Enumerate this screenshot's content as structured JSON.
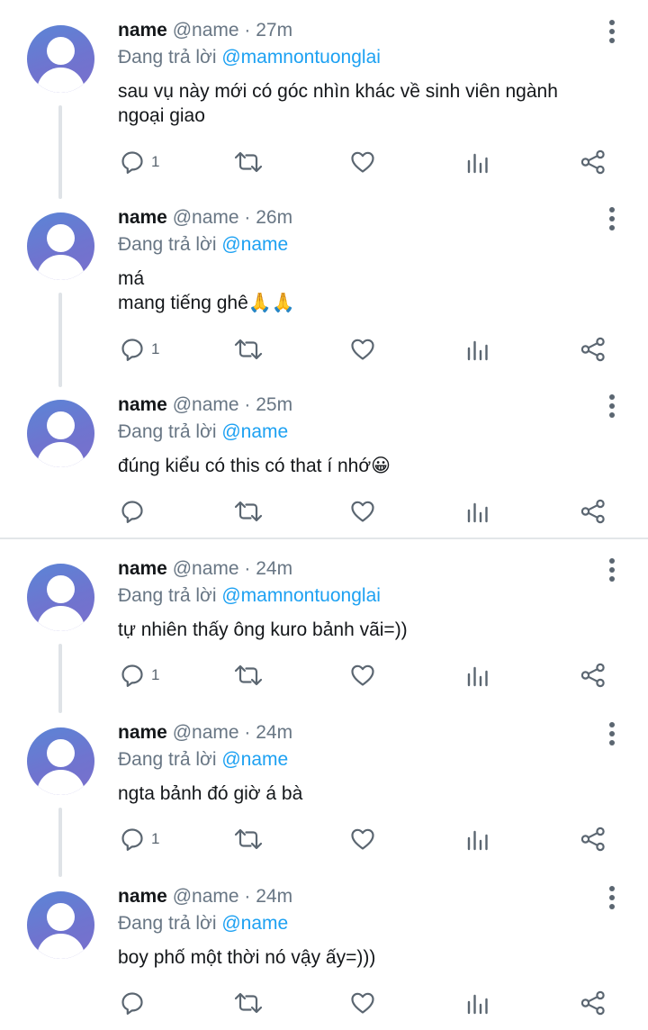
{
  "tweets": [
    {
      "name": "name",
      "handle": "@name",
      "time": "27m",
      "reply_prefix": "Đang trả lời",
      "mention": "@mamnontuonglai",
      "lines": [
        "sau vụ này mới có góc nhìn khác về sinh viên ngành",
        "ngoại giao"
      ],
      "reply_count": "1"
    },
    {
      "name": "name",
      "handle": "@name",
      "time": "26m",
      "reply_prefix": "Đang trả lời",
      "mention": "@name",
      "lines": [
        "má",
        "mang tiếng ghê🙏🙏"
      ],
      "reply_count": "1"
    },
    {
      "name": "name",
      "handle": "@name",
      "time": "25m",
      "reply_prefix": "Đang trả lời",
      "mention": "@name",
      "lines": [
        "đúng kiểu có this có that í nhớ😀"
      ],
      "reply_count": ""
    },
    {
      "name": "name",
      "handle": "@name",
      "time": "24m",
      "reply_prefix": "Đang trả lời",
      "mention": "@mamnontuonglai",
      "lines": [
        "tự nhiên thấy ông kuro bảnh vãi=))"
      ],
      "reply_count": "1"
    },
    {
      "name": "name",
      "handle": "@name",
      "time": "24m",
      "reply_prefix": "Đang trả lời",
      "mention": "@name",
      "lines": [
        "ngta bảnh đó giờ á bà"
      ],
      "reply_count": "1"
    },
    {
      "name": "name",
      "handle": "@name",
      "time": "24m",
      "reply_prefix": "Đang trả lời",
      "mention": "@name",
      "lines": [
        "boy phố một thời nó vậy ấy=)))"
      ],
      "reply_count": ""
    }
  ],
  "icons": {
    "more": "more-vertical-icon",
    "reply": "reply-icon",
    "retweet": "retweet-icon",
    "like": "heart-icon",
    "analytics": "analytics-icon",
    "share": "share-icon"
  },
  "colors": {
    "mention": "#1da1f2",
    "meta": "#687684",
    "icon": "#5b6671",
    "avatar": "#6f74cf"
  }
}
